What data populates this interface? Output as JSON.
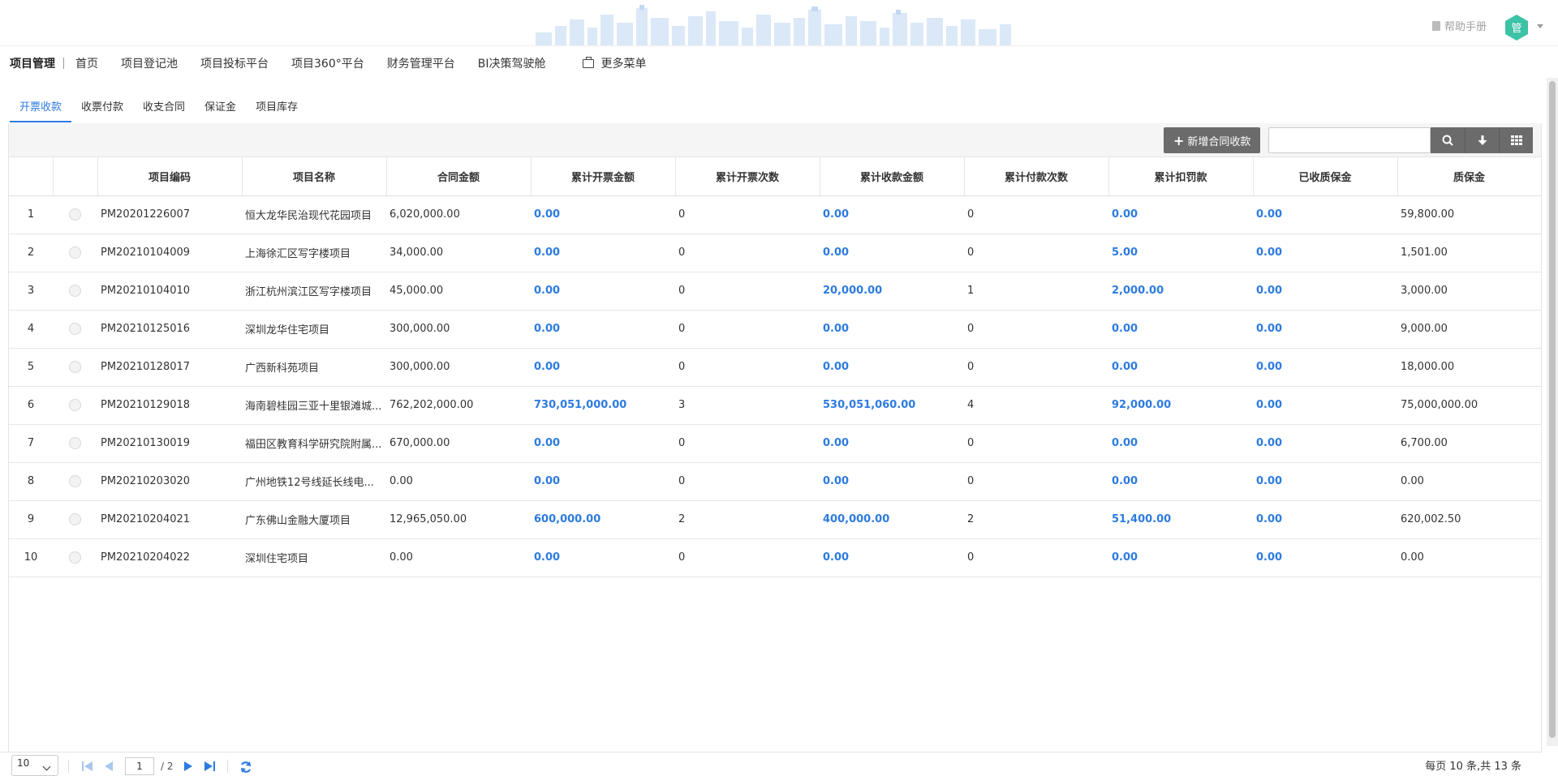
{
  "header": {
    "help_label": "帮助手册",
    "avatar_text": "管",
    "avatar_color": "#3cc2a4"
  },
  "nav": {
    "brand": "项目管理",
    "items": [
      "首页",
      "项目登记池",
      "项目投标平台",
      "项目360°平台",
      "财务管理平台",
      "BI决策驾驶舱"
    ],
    "more_label": "更多菜单"
  },
  "tabs": [
    "开票收款",
    "收票付款",
    "收支合同",
    "保证金",
    "项目库存"
  ],
  "toolbar": {
    "add_label": "新增合同收款",
    "search_placeholder": ""
  },
  "table": {
    "columns": [
      "",
      "",
      "项目编码",
      "项目名称",
      "合同金额",
      "累计开票金额",
      "累计开票次数",
      "累计收款金额",
      "累计付款次数",
      "累计扣罚款",
      "已收质保金",
      "质保金"
    ],
    "rows": [
      [
        "1",
        "PM20201226007",
        "恒大龙华民治现代花园项目",
        "6,020,000.00",
        "0.00",
        "0",
        "0.00",
        "0",
        "0.00",
        "0.00",
        "59,800.00"
      ],
      [
        "2",
        "PM20210104009",
        "上海徐汇区写字楼项目",
        "34,000.00",
        "0.00",
        "0",
        "0.00",
        "0",
        "5.00",
        "0.00",
        "1,501.00"
      ],
      [
        "3",
        "PM20210104010",
        "浙江杭州滨江区写字楼项目",
        "45,000.00",
        "0.00",
        "0",
        "20,000.00",
        "1",
        "2,000.00",
        "0.00",
        "3,000.00"
      ],
      [
        "4",
        "PM20210125016",
        "深圳龙华住宅项目",
        "300,000.00",
        "0.00",
        "0",
        "0.00",
        "0",
        "0.00",
        "0.00",
        "9,000.00"
      ],
      [
        "5",
        "PM20210128017",
        "广西新科苑项目",
        "300,000.00",
        "0.00",
        "0",
        "0.00",
        "0",
        "0.00",
        "0.00",
        "18,000.00"
      ],
      [
        "6",
        "PM20210129018",
        "海南碧桂园三亚十里银滩城...",
        "762,202,000.00",
        "730,051,000.00",
        "3",
        "530,051,060.00",
        "4",
        "92,000.00",
        "0.00",
        "75,000,000.00"
      ],
      [
        "7",
        "PM20210130019",
        "福田区教育科学研究院附属...",
        "670,000.00",
        "0.00",
        "0",
        "0.00",
        "0",
        "0.00",
        "0.00",
        "6,700.00"
      ],
      [
        "8",
        "PM20210203020",
        "广州地铁12号线延长线电...",
        "0.00",
        "0.00",
        "0",
        "0.00",
        "0",
        "0.00",
        "0.00",
        "0.00"
      ],
      [
        "9",
        "PM20210204021",
        "广东佛山金融大厦项目",
        "12,965,050.00",
        "600,000.00",
        "2",
        "400,000.00",
        "2",
        "51,400.00",
        "0.00",
        "620,002.50"
      ],
      [
        "10",
        "PM20210204022",
        "深圳住宅项目",
        "0.00",
        "0.00",
        "0",
        "0.00",
        "0",
        "0.00",
        "0.00",
        "0.00"
      ]
    ]
  },
  "pager": {
    "page_size": "10",
    "current_page": "1",
    "total_pages": "/ 2",
    "summary": "每页 10 条,共 13 条"
  },
  "colors": {
    "accent": "#2d7be0",
    "button_bg": "#6b6b6b"
  }
}
